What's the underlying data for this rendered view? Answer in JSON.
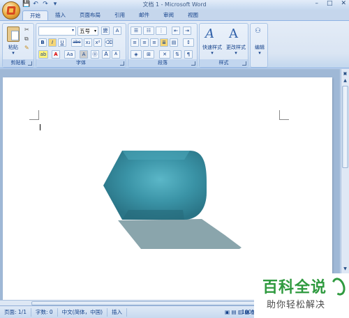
{
  "window": {
    "title": "文档 1 - Microsoft Word",
    "controls": [
      "–",
      "□",
      "✕"
    ]
  },
  "qat": [
    "💾",
    "↶",
    "↷",
    "▾"
  ],
  "tabs": [
    {
      "label": "开始",
      "active": true
    },
    {
      "label": "插入"
    },
    {
      "label": "页面布局"
    },
    {
      "label": "引用"
    },
    {
      "label": "邮件"
    },
    {
      "label": "审阅"
    },
    {
      "label": "视图"
    }
  ],
  "ribbon": {
    "clipboard": {
      "label": "剪贴板",
      "paste_label": "粘贴"
    },
    "font": {
      "label": "字体",
      "font_name": "",
      "font_size": "五号",
      "buttons": [
        "B",
        "I",
        "U",
        "abe",
        "x₂",
        "x²",
        "A",
        "Aa",
        "A",
        "A"
      ]
    },
    "paragraph": {
      "label": "段落"
    },
    "styles": {
      "label": "样式",
      "quick_styles": "快速样式",
      "change_styles": "更改样式"
    },
    "editing": {
      "label": "编辑"
    }
  },
  "status": {
    "page": "页面: 1/1",
    "words": "字数: 0",
    "language": "中文(简体，中国)",
    "mode": "插入",
    "zoom": "100%"
  },
  "watermark": {
    "title": "百科全说",
    "subtitle": "助你轻松解决"
  },
  "colors": {
    "shape_fill": "#3a93a6",
    "shape_shadow": "#8aa5ac",
    "accent": "#2f9a3f"
  }
}
